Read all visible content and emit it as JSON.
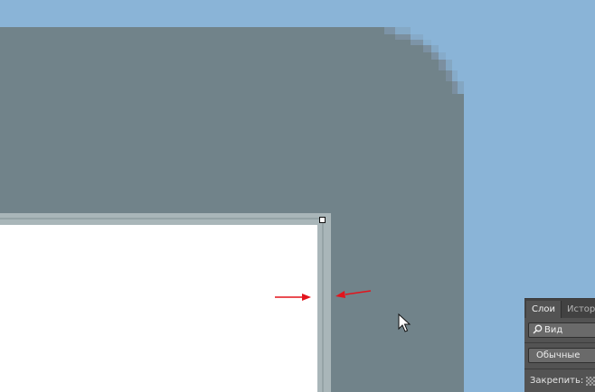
{
  "colors": {
    "zoomed_background": "#8ab4d7",
    "canvas_gray": "#71838a",
    "frame_gray": "#a9b6b9",
    "document_white": "#ffffff",
    "annotation_arrow": "#e3141c",
    "panel_dark": "#535353"
  },
  "icons": {
    "selection_handle": "square-handle-icon",
    "cursor": "mouse-pointer-icon",
    "annotation": "red-arrow-icon",
    "search": "magnifier-icon",
    "lock_transparency": "checkerboard-icon"
  },
  "layers_panel": {
    "tabs": [
      {
        "label": "Слои",
        "active": true
      },
      {
        "label": "Истор",
        "active": false
      }
    ],
    "filter_label": "Вид",
    "blend_mode": "Обычные",
    "lock_label": "Закрепить:"
  }
}
